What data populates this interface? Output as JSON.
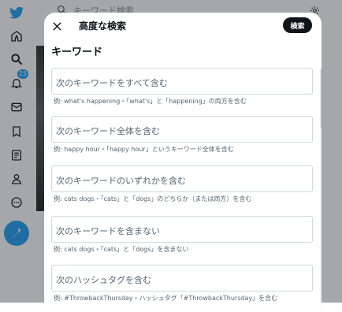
{
  "background": {
    "search_placeholder": "キーワード検索",
    "notifications_count": "15",
    "nav_icons": [
      "twitter-logo-icon",
      "home-icon",
      "explore-icon",
      "notifications-icon",
      "messages-icon",
      "bookmarks-icon",
      "lists-icon",
      "profile-icon",
      "more-icon",
      "compose-tweet-icon"
    ],
    "accent_color": "#1d9bf0"
  },
  "modal": {
    "title": "高度な検索",
    "search_button_label": "検索",
    "section_heading": "キーワード",
    "fields": [
      {
        "label": "次のキーワードをすべて含む",
        "hint": "例: what's happening・「what's」と「happening」の両方を含む"
      },
      {
        "label": "次のキーワード全体を含む",
        "hint": "例: happy hour・「happy hour」というキーワード全体を含む"
      },
      {
        "label": "次のキーワードのいずれかを含む",
        "hint": "例: cats dogs・「cats」と「dogs」のどちらか（または両方）を含む"
      },
      {
        "label": "次のキーワードを含まない",
        "hint": "例: cats dogs・「cats」と「dogs」を含まない"
      },
      {
        "label": "次のハッシュタグを含む",
        "hint": "例: #ThrowbackThursday・ハッシュタグ「#ThrowbackThursday」を含む"
      }
    ]
  }
}
